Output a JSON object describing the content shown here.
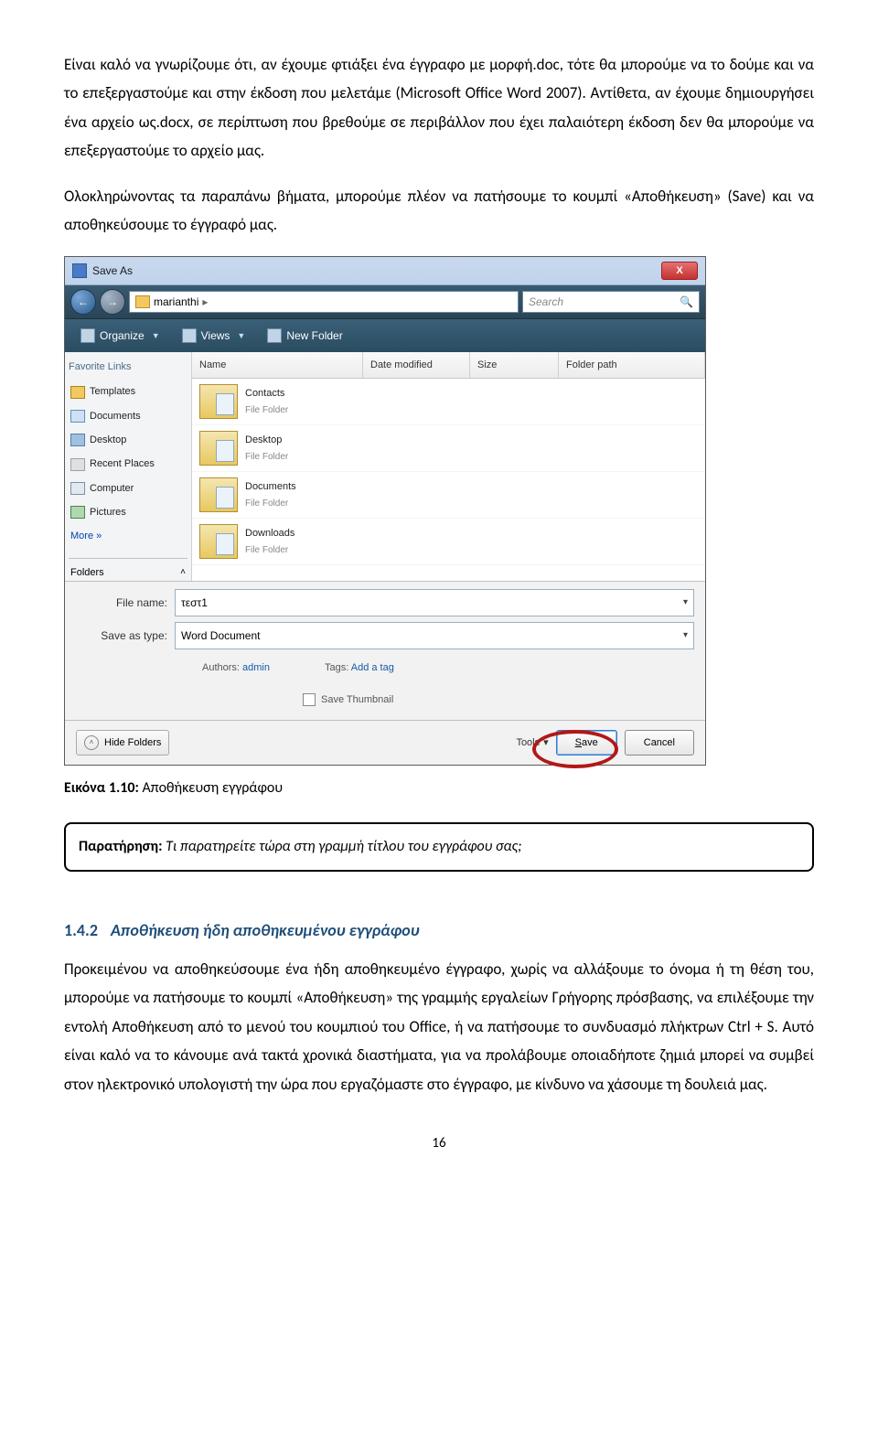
{
  "paragraph1": "Είναι καλό να γνωρίζουμε ότι, αν έχουμε φτιάξει ένα έγγραφο με μορφή.doc, τότε θα μπορούμε να το δούμε και να το επεξεργαστούμε και στην έκδοση που μελετάμε (Microsoft Office Word 2007). Αντίθετα, αν έχουμε δημιουργήσει ένα αρχείο ως.docx, σε περίπτωση που βρεθούμε σε περιβάλλον που έχει παλαιότερη έκδοση δεν θα μπορούμε να επεξεργαστούμε το αρχείο μας.",
  "paragraph2": "Ολοκληρώνοντας τα παραπάνω βήματα, μπορούμε πλέον να πατήσουμε το κουμπί «Αποθήκευση» (Save) και να αποθηκεύσουμε το έγγραφό μας.",
  "caption_label": "Εικόνα 1.10:",
  "caption_text": " Αποθήκευση εγγράφου",
  "note_label": "Παρατήρηση:",
  "note_text": " Τι παρατηρείτε τώρα στη γραμμή τίτλου του εγγράφου σας;",
  "section_num": "1.4.2",
  "section_title": "Αποθήκευση ήδη αποθηκευμένου εγγράφου",
  "paragraph3": "Προκειμένου να αποθηκεύσουμε ένα ήδη αποθηκευμένο έγγραφο, χωρίς να αλλάξουμε το όνομα ή τη θέση του, μπορούμε να πατήσουμε το κουμπί «Αποθήκευση» της γραμμής εργαλείων Γρήγορης πρόσβασης, να επιλέξουμε την εντολή Αποθήκευση από το μενού του κουμπιού του Office, ή να πατήσουμε το συνδυασμό πλήκτρων Ctrl + S. Αυτό είναι καλό να το κάνουμε ανά τακτά χρονικά διαστήματα, για να προλάβουμε οποιαδήποτε ζημιά μπορεί να συμβεί στον ηλεκτρονικό υπολογιστή την ώρα που εργαζόμαστε στο έγγραφο, με κίνδυνο να χάσουμε τη δουλειά μας.",
  "page_number": "16",
  "dialog": {
    "title": "Save As",
    "close_x": "X",
    "back_arrow": "←",
    "fwd_arrow": "→",
    "breadcrumb_user": "marianthi",
    "breadcrumb_sep": "▸",
    "search_placeholder": "Search",
    "search_icon": "🔍",
    "tb_organize": "Organize",
    "tb_views": "Views",
    "tb_newfolder": "New Folder",
    "sidebar_header": "Favorite Links",
    "sidebar": [
      "Templates",
      "Documents",
      "Desktop",
      "Recent Places",
      "Computer",
      "Pictures"
    ],
    "sidebar_more": "More  »",
    "folders_label": "Folders",
    "folders_chevron": "˄",
    "columns": {
      "name": "Name",
      "date": "Date modified",
      "size": "Size",
      "folder": "Folder path"
    },
    "rows": [
      {
        "name": "Contacts",
        "sub": "File Folder"
      },
      {
        "name": "Desktop",
        "sub": "File Folder"
      },
      {
        "name": "Documents",
        "sub": "File Folder"
      },
      {
        "name": "Downloads",
        "sub": "File Folder"
      }
    ],
    "labels": {
      "filename": "File name:",
      "saveas": "Save as type:",
      "authors": "Authors:",
      "tags": "Tags:"
    },
    "values": {
      "filename": "τεστ1",
      "saveas": "Word Document",
      "authors": "admin",
      "tags": "Add a tag"
    },
    "thumbnail_label": "Save Thumbnail",
    "hide_folders": "Hide Folders",
    "tools": "Tools",
    "save": "Save",
    "cancel": "Cancel"
  }
}
